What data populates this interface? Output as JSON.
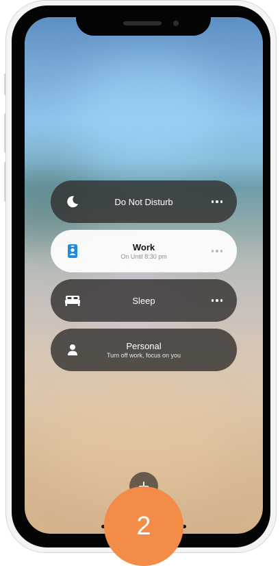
{
  "colors": {
    "card_dark": "#2e2c2a",
    "card_light": "#ffffff",
    "work_icon_blue": "#1f8ae0",
    "step_badge": "#f28c46"
  },
  "focus_modes": [
    {
      "title": "Do Not Disturb",
      "subtitle": "",
      "icon": "moon-icon",
      "style": "dark",
      "more": "ellipsis-icon"
    },
    {
      "title": "Work",
      "subtitle": "On Until 8:30 pm",
      "icon": "id-badge-icon",
      "style": "light",
      "more": "ellipsis-icon"
    },
    {
      "title": "Sleep",
      "subtitle": "",
      "icon": "bed-icon",
      "style": "dark",
      "more": "ellipsis-icon"
    },
    {
      "title": "Personal",
      "subtitle": "Turn off work, focus on you",
      "icon": "person-icon",
      "style": "dark"
    }
  ],
  "add_button": {
    "icon": "plus-icon"
  },
  "step_badge": {
    "label": "2"
  }
}
